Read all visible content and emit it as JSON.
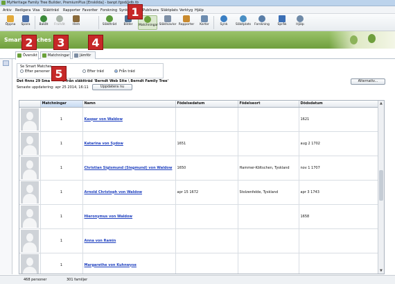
{
  "window": {
    "title": "MyHeritage Family Tree Builder, PremiumPlus [Enskilda] - banpt.fgod@db.tb"
  },
  "menu": [
    "Arkiv",
    "Redigera",
    "Visa",
    "Släktträd",
    "Rapporter",
    "Favoriter",
    "Forskning",
    "Synk",
    "Publicera",
    "Släktplats",
    "Verktyg",
    "Hjälp"
  ],
  "toolbar": [
    {
      "label": "Öppna",
      "icon": "open-folder-icon",
      "color": "#e2a93a",
      "disabled": false
    },
    {
      "label": "Spara",
      "icon": "save-icon",
      "color": "#4a6fa8",
      "disabled": false
    },
    {
      "label": "Bakåt",
      "icon": "back-arrow-icon",
      "color": "#3b8a3b",
      "disabled": false
    },
    {
      "label": "Framåt",
      "icon": "forward-arrow-icon",
      "color": "#a8b3a8",
      "disabled": true
    },
    {
      "label": "Hem",
      "icon": "home-icon",
      "color": "#8a6a3b",
      "disabled": false
    },
    {
      "label": "Släktträd",
      "icon": "tree-icon",
      "color": "#5a9a3a",
      "disabled": false
    },
    {
      "label": "Bilder",
      "icon": "photos-icon",
      "color": "#4d6f93",
      "disabled": false
    },
    {
      "label": "Matchningar",
      "icon": "matches-icon",
      "color": "#6aa13a",
      "disabled": false
    },
    {
      "label": "Släktsavlor",
      "icon": "charts-icon",
      "color": "#7d8fa6",
      "disabled": false
    },
    {
      "label": "Rapporter",
      "icon": "reports-icon",
      "color": "#c98a2e",
      "disabled": false
    },
    {
      "label": "Kartor",
      "icon": "map-icon",
      "color": "#6d8caf",
      "disabled": false
    },
    {
      "label": "Synk",
      "icon": "sync-icon",
      "color": "#3a7fc4",
      "disabled": false
    },
    {
      "label": "Släktplats",
      "icon": "family-site-icon",
      "color": "#4a8fc4",
      "disabled": false
    },
    {
      "label": "Forskning",
      "icon": "research-icon",
      "color": "#5a7ea8",
      "disabled": false
    },
    {
      "label": "Språk",
      "icon": "language-flag-icon",
      "color": "#3b6fb6",
      "disabled": false
    },
    {
      "label": "Hjälp",
      "icon": "help-icon",
      "color": "#6f8aa8",
      "disabled": false
    }
  ],
  "banner": {
    "title": "Smart Matches"
  },
  "tabs": [
    {
      "label": "Översikt",
      "active": true
    },
    {
      "label": "Matchningar",
      "active": false
    },
    {
      "label": "Jämför",
      "active": false
    }
  ],
  "filter": {
    "title": "Se Smart Matches",
    "options": [
      {
        "label": "Efter personer",
        "selected": false
      },
      {
        "label": "Efter träd",
        "selected": false
      },
      {
        "label": "Från träd",
        "selected": true
      }
    ]
  },
  "info": {
    "line1_start": "Det finns 29 Sma",
    "line1_end": "s från släktträd 'Berndt Web Site \\ Berndt Family Tree'",
    "updated": "Senaste uppdatering: apr 25 2014, 16:11",
    "update_button": "Uppdatera nu",
    "options_button": "Alternativ..."
  },
  "table": {
    "columns": [
      "",
      "Matchningar",
      "Namn",
      "Födelsedatum",
      "Födelseort",
      "Dödsdatum"
    ],
    "rows": [
      {
        "matches": "1",
        "name": "Kaspar von Waldow",
        "birth_date": "",
        "birth_place": "",
        "death_date": "1621"
      },
      {
        "matches": "1",
        "name": "Katarina von Sydow",
        "birth_date": "1651",
        "birth_place": "",
        "death_date": "aug 2 1702"
      },
      {
        "matches": "1",
        "name": "Christian Sigismund (Siegmund) von Waldow",
        "birth_date": "1650",
        "birth_place": "Hammer-Költschen, Tyskland",
        "death_date": "nov 1 1707"
      },
      {
        "matches": "1",
        "name": "Arnold Christoph von Waldow",
        "birth_date": "apr 15 1672",
        "birth_place": "Stolzenfelde, Tyskland",
        "death_date": "apr 3 1743"
      },
      {
        "matches": "1",
        "name": "Hieronymus von Waldow",
        "birth_date": "",
        "birth_place": "",
        "death_date": "1658"
      },
      {
        "matches": "1",
        "name": "Anna von Ramin",
        "birth_date": "",
        "birth_place": "",
        "death_date": ""
      },
      {
        "matches": "1",
        "name": "Margarethe von Kuhnwyse",
        "birth_date": "",
        "birth_place": "",
        "death_date": ""
      }
    ]
  },
  "status": {
    "persons": "468 personer",
    "families": "301 familjer"
  },
  "callouts": [
    "1",
    "2",
    "3",
    "4",
    "5"
  ]
}
